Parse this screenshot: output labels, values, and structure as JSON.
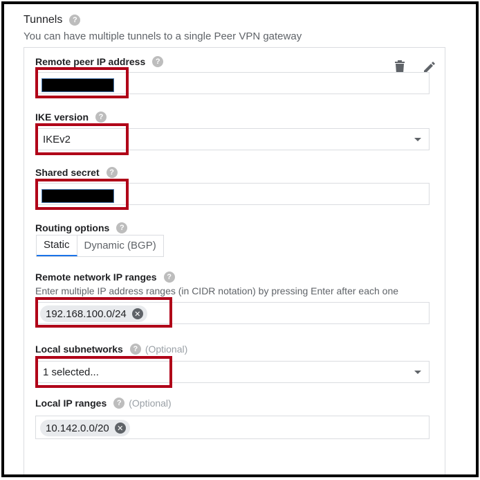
{
  "tunnels": {
    "title": "Tunnels",
    "subtitle": "You can have multiple tunnels to a single Peer VPN gateway"
  },
  "card": {
    "actions": [
      {
        "name": "delete",
        "icon": "trash-icon"
      },
      {
        "name": "edit",
        "icon": "pencil-icon"
      }
    ]
  },
  "fields": {
    "remote_peer_ip": {
      "label": "Remote peer IP address",
      "value_redacted": true
    },
    "ike_version": {
      "label": "IKE version",
      "value": "IKEv2"
    },
    "shared_secret": {
      "label": "Shared secret",
      "value_redacted": true
    },
    "routing_options": {
      "label": "Routing options",
      "options": [
        "Static",
        "Dynamic (BGP)"
      ],
      "selected": "Static"
    },
    "remote_network_ranges": {
      "label": "Remote network IP ranges",
      "hint": "Enter multiple IP address ranges (in CIDR notation) by pressing Enter after each one",
      "chips": [
        "192.168.100.0/24"
      ]
    },
    "local_subnetworks": {
      "label": "Local subnetworks",
      "optional": "(Optional)",
      "value": "1 selected..."
    },
    "local_ip_ranges": {
      "label": "Local IP ranges",
      "optional": "(Optional)",
      "chips": [
        "10.142.0.0/20"
      ]
    }
  },
  "colors": {
    "highlight": "#b00018",
    "accent": "#1a73e8"
  }
}
